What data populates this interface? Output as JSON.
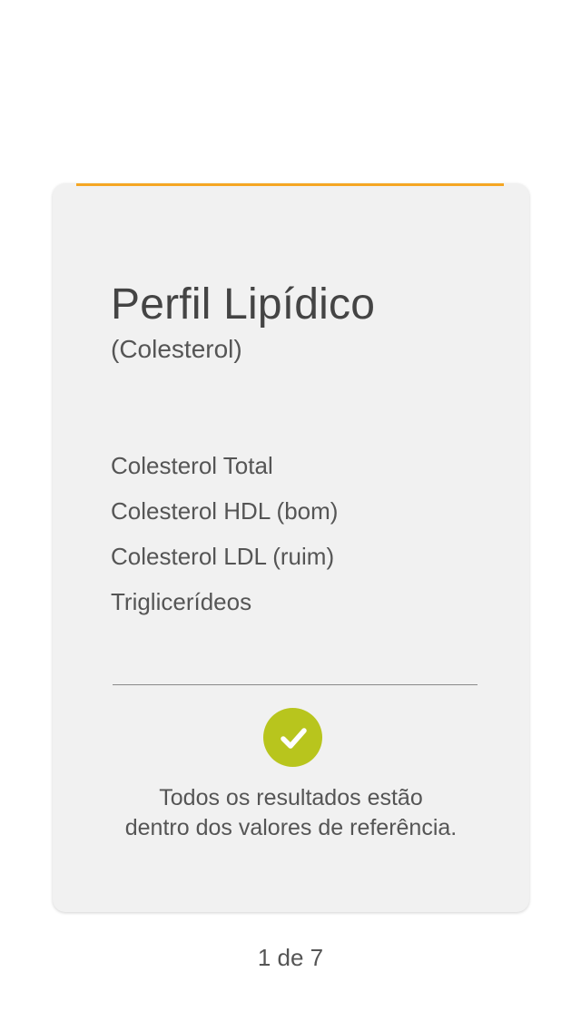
{
  "card": {
    "title": "Perfil Lipídico",
    "subtitle": "(Colesterol)",
    "tests": [
      "Colesterol Total",
      "Colesterol HDL (bom)",
      "Colesterol LDL (ruim)",
      "Triglicerídeos"
    ],
    "status_icon": "check-icon",
    "status_line1": "Todos os resultados estão",
    "status_line2": "dentro dos valores de referência."
  },
  "pager": {
    "label": "1 de 7"
  },
  "colors": {
    "accent": "#f5a623",
    "success": "#b8c51d",
    "card_background": "#f1f1f1"
  }
}
